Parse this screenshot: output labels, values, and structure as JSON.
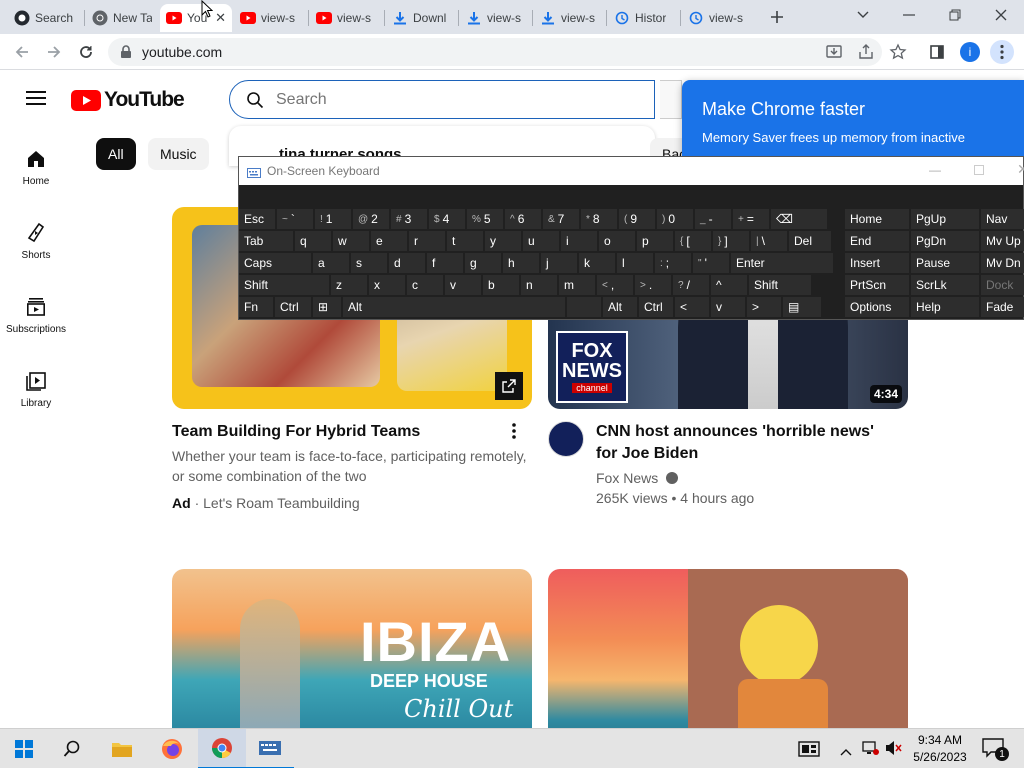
{
  "browser": {
    "tabs": [
      {
        "label": "Search",
        "icon": "github-icon"
      },
      {
        "label": "New Tab",
        "icon": "chrome-icon"
      },
      {
        "label": "YouTube",
        "icon": "youtube-icon"
      },
      {
        "label": "view-s",
        "icon": "youtube-icon"
      },
      {
        "label": "view-s",
        "icon": "youtube-icon"
      },
      {
        "label": "Downl",
        "icon": "download-icon"
      },
      {
        "label": "view-s",
        "icon": "download-icon"
      },
      {
        "label": "view-s",
        "icon": "download-icon"
      },
      {
        "label": "Histor",
        "icon": "history-icon"
      },
      {
        "label": "view-s",
        "icon": "history-icon"
      }
    ],
    "active_tab": 2,
    "address": "youtube.com",
    "profile_initial": "i"
  },
  "youtube": {
    "logo_text": "YouTube",
    "search_placeholder": "Search",
    "suggestion": "tina turner songs",
    "chips": [
      "All",
      "Music",
      "Bac"
    ],
    "sidebar": [
      {
        "label": "Home",
        "icon": "home-icon"
      },
      {
        "label": "Shorts",
        "icon": "shorts-icon"
      },
      {
        "label": "Subscriptions",
        "icon": "subscriptions-icon"
      },
      {
        "label": "Library",
        "icon": "library-icon"
      }
    ],
    "videos": [
      {
        "title": "Team Building For Hybrid Teams",
        "desc": "Whether your team is face-to-face, participating remotely, or some combination of the two",
        "ad_label": "Ad",
        "advertiser": "Let's Roam Teambuilding"
      },
      {
        "title": "CNN host announces 'horrible news' for Joe Biden",
        "channel": "Fox News",
        "meta": "265K views • 4 hours ago",
        "duration": "4:34",
        "logo_top": "FOX",
        "logo_mid": "NEWS",
        "logo_bottom": "channel"
      },
      {
        "overlay_title": "IBIZA",
        "overlay_sub": "DEEP HOUSE",
        "overlay_script": "Chill Out"
      },
      {}
    ]
  },
  "popup": {
    "title": "Make Chrome faster",
    "body": "Memory Saver frees up memory from inactive"
  },
  "osk": {
    "title": "On-Screen Keyboard",
    "rows": [
      [
        [
          "Esc",
          ""
        ],
        [
          "`",
          "~"
        ],
        [
          "1",
          "!"
        ],
        [
          "2",
          "@"
        ],
        [
          "3",
          "#"
        ],
        [
          "4",
          "$"
        ],
        [
          "5",
          "%"
        ],
        [
          "6",
          "^"
        ],
        [
          "7",
          "&"
        ],
        [
          "8",
          "*"
        ],
        [
          "9",
          "("
        ],
        [
          "0",
          ")"
        ],
        [
          "-",
          "_"
        ],
        [
          "=",
          "+"
        ],
        [
          "⌫",
          ""
        ]
      ],
      [
        [
          "Tab",
          ""
        ],
        [
          "q",
          ""
        ],
        [
          "w",
          ""
        ],
        [
          "e",
          ""
        ],
        [
          "r",
          ""
        ],
        [
          "t",
          ""
        ],
        [
          "y",
          ""
        ],
        [
          "u",
          ""
        ],
        [
          "i",
          ""
        ],
        [
          "o",
          ""
        ],
        [
          "p",
          ""
        ],
        [
          "[",
          "{"
        ],
        [
          "]",
          "}"
        ],
        [
          "\\",
          "|"
        ],
        [
          "Del",
          ""
        ]
      ],
      [
        [
          "Caps",
          ""
        ],
        [
          "a",
          ""
        ],
        [
          "s",
          ""
        ],
        [
          "d",
          ""
        ],
        [
          "f",
          ""
        ],
        [
          "g",
          ""
        ],
        [
          "h",
          ""
        ],
        [
          "j",
          ""
        ],
        [
          "k",
          ""
        ],
        [
          "l",
          ""
        ],
        [
          ";",
          ":"
        ],
        [
          "'",
          "\""
        ],
        [
          "Enter",
          ""
        ]
      ],
      [
        [
          "Shift",
          ""
        ],
        [
          "z",
          ""
        ],
        [
          "x",
          ""
        ],
        [
          "c",
          ""
        ],
        [
          "v",
          ""
        ],
        [
          "b",
          ""
        ],
        [
          "n",
          ""
        ],
        [
          "m",
          ""
        ],
        [
          ",",
          "<"
        ],
        [
          ".",
          ">"
        ],
        [
          "/",
          "?"
        ],
        [
          "^",
          ""
        ],
        [
          "Shift",
          ""
        ]
      ],
      [
        [
          "Fn",
          ""
        ],
        [
          "Ctrl",
          ""
        ],
        [
          "⊞",
          ""
        ],
        [
          "Alt",
          ""
        ],
        [
          "",
          ""
        ],
        [
          "Alt",
          ""
        ],
        [
          "Ctrl",
          ""
        ],
        [
          "<",
          ""
        ],
        [
          "v",
          ""
        ],
        [
          ">",
          ""
        ],
        [
          "▤",
          ""
        ]
      ]
    ],
    "nav": [
      [
        "Home",
        "PgUp",
        "Nav"
      ],
      [
        "End",
        "PgDn",
        "Mv Up"
      ],
      [
        "Insert",
        "Pause",
        "Mv Dn"
      ],
      [
        "PrtScn",
        "ScrLk",
        "Dock"
      ],
      [
        "Options",
        "Help",
        "Fade"
      ]
    ]
  },
  "taskbar": {
    "time": "9:34 AM",
    "date": "5/26/2023",
    "notification_count": "1"
  }
}
